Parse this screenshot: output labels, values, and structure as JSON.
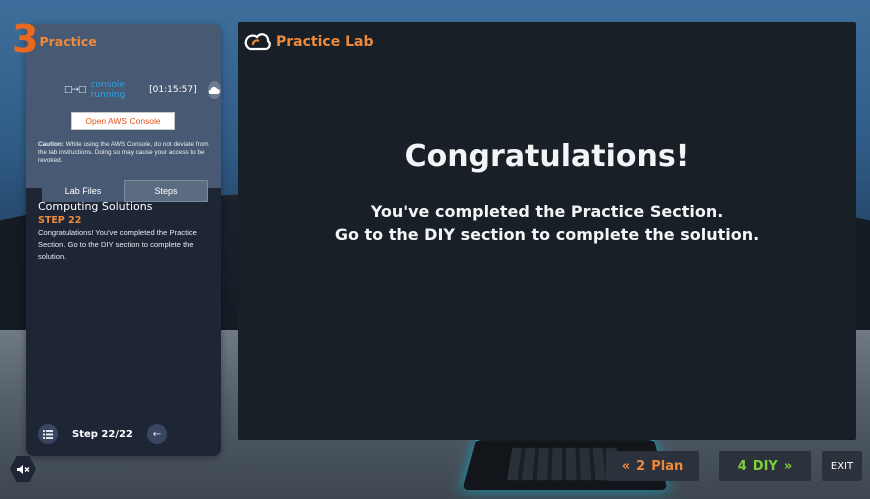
{
  "section": {
    "number": "3",
    "title": "Practice"
  },
  "console": {
    "icon": "□→□",
    "status": "console running",
    "timer": "[01:15:57]"
  },
  "buttons": {
    "open_console": "Open AWS Console"
  },
  "caution": {
    "label": "Caution:",
    "text": " While using the AWS Console, do not deviate from the lab instructions. Doing so may cause your access to be revoked."
  },
  "tabs": [
    {
      "label": "Lab Files"
    },
    {
      "label": "Steps"
    }
  ],
  "step": {
    "heading": "Computing Solutions",
    "label": "STEP 22",
    "text": "Congratulations! You've completed the Practice Section. Go to the DIY section to complete the solution."
  },
  "footer": {
    "counter": "Step 22/22"
  },
  "main": {
    "brand": "Practice Lab",
    "title": "Congratulations!",
    "line1": "You've completed the Practice Section.",
    "line2": "Go to the DIY section to complete the solution."
  },
  "nav": {
    "prev_number": "2",
    "prev_label": "Plan",
    "next_number": "4",
    "next_label": "DIY",
    "exit_label": "EXIT"
  },
  "colors": {
    "accent_orange": "#f08a3b",
    "accent_green": "#7ecf3a",
    "console_blue": "#2ba5e7"
  },
  "icons": [
    "cloud-icon",
    "list-icon",
    "back-arrow-icon",
    "mute-icon",
    "double-chevron-left-icon",
    "double-chevron-right-icon",
    "practice-lab-logo-icon"
  ]
}
